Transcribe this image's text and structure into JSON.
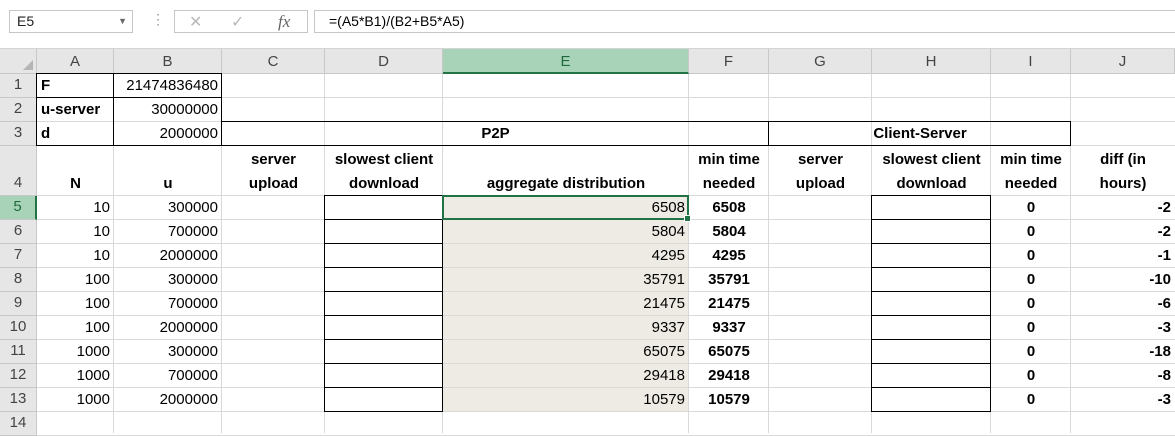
{
  "formula_bar": {
    "name_box": "E5",
    "fx_label": "fx",
    "formula": "=(A5*B1)/(B2+B5*A5)"
  },
  "columns": [
    "A",
    "B",
    "C",
    "D",
    "E",
    "F",
    "G",
    "H",
    "I",
    "J"
  ],
  "selected_column": "E",
  "rows": [
    "1",
    "2",
    "3",
    "4",
    "5",
    "6",
    "7",
    "8",
    "9",
    "10",
    "11",
    "12",
    "13",
    "14"
  ],
  "selected_row": "5",
  "params": [
    {
      "label": "F",
      "value": "21474836480"
    },
    {
      "label": "u-server",
      "value": "30000000"
    },
    {
      "label": "d",
      "value": "2000000"
    }
  ],
  "group_headers": {
    "p2p": "P2P",
    "client_server": "Client-Server"
  },
  "header_row": {
    "A": [
      "",
      "N"
    ],
    "B": [
      "",
      "u"
    ],
    "C": [
      "server",
      "upload"
    ],
    "D": [
      "slowest client",
      "download"
    ],
    "E": [
      "",
      "aggregate distribution"
    ],
    "F": [
      "min time",
      "needed"
    ],
    "G": [
      "server",
      "upload"
    ],
    "H": [
      "slowest client",
      "download"
    ],
    "I": [
      "min time",
      "needed"
    ],
    "J": [
      "diff (in",
      "hours)"
    ]
  },
  "table": [
    {
      "n": "10",
      "u": "300000",
      "agg": "6508",
      "p2p_min": "6508",
      "cs_min": "0",
      "diff": "-2"
    },
    {
      "n": "10",
      "u": "700000",
      "agg": "5804",
      "p2p_min": "5804",
      "cs_min": "0",
      "diff": "-2"
    },
    {
      "n": "10",
      "u": "2000000",
      "agg": "4295",
      "p2p_min": "4295",
      "cs_min": "0",
      "diff": "-1"
    },
    {
      "n": "100",
      "u": "300000",
      "agg": "35791",
      "p2p_min": "35791",
      "cs_min": "0",
      "diff": "-10"
    },
    {
      "n": "100",
      "u": "700000",
      "agg": "21475",
      "p2p_min": "21475",
      "cs_min": "0",
      "diff": "-6"
    },
    {
      "n": "100",
      "u": "2000000",
      "agg": "9337",
      "p2p_min": "9337",
      "cs_min": "0",
      "diff": "-3"
    },
    {
      "n": "1000",
      "u": "300000",
      "agg": "65075",
      "p2p_min": "65075",
      "cs_min": "0",
      "diff": "-18"
    },
    {
      "n": "1000",
      "u": "700000",
      "agg": "29418",
      "p2p_min": "29418",
      "cs_min": "0",
      "diff": "-8"
    },
    {
      "n": "1000",
      "u": "2000000",
      "agg": "10579",
      "p2p_min": "10579",
      "cs_min": "0",
      "diff": "-3"
    }
  ],
  "colors": {
    "accent": "#217346",
    "selected_header": "#a9d3b8",
    "shaded_column": "#edebe3"
  }
}
